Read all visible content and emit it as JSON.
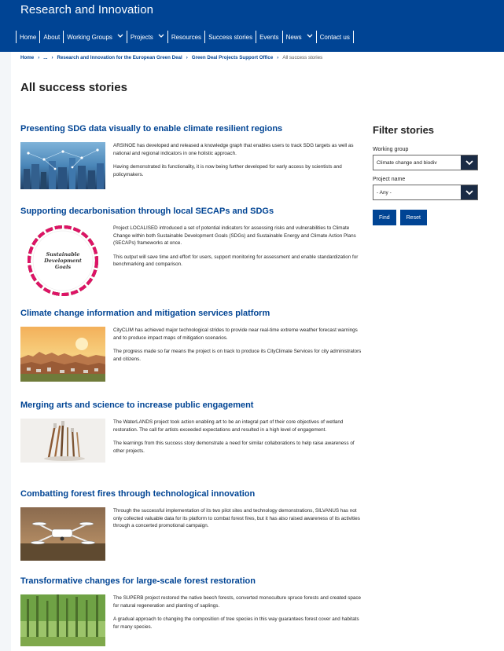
{
  "header": {
    "site_title": "Research and Innovation",
    "nav": [
      {
        "label": "Home",
        "dropdown": false
      },
      {
        "label": "About",
        "dropdown": false
      },
      {
        "label": "Working Groups",
        "dropdown": true
      },
      {
        "label": "Projects",
        "dropdown": true
      },
      {
        "label": "Resources",
        "dropdown": false
      },
      {
        "label": "Success stories",
        "dropdown": false
      },
      {
        "label": "Events",
        "dropdown": false
      },
      {
        "label": "News",
        "dropdown": true
      },
      {
        "label": "Contact us",
        "dropdown": false
      }
    ]
  },
  "breadcrumb": {
    "items": [
      "Home",
      "...",
      "Research and Innovation for the European Green Deal",
      "Green Deal Projects Support Office",
      "All success stories"
    ]
  },
  "page": {
    "title": "All success stories"
  },
  "stories": [
    {
      "title": "Presenting SDG data visually to enable climate resilient regions",
      "paragraphs": [
        "ARSINOE has developed and released a knowledge graph that enables users to track SDG targets as well as national and regional indicators in one holistic approach.",
        "Having demonstrated its functionality, it is now being further developed for early access by scientists and policymakers."
      ]
    },
    {
      "title": "Supporting decarbonisation through local SECAPs and SDGs",
      "paragraphs": [
        "Project LOCALISED introduced a set of potential indicators for assessing risks and vulnerabilities to Climate Change within both Sustainable Development Goals (SDGs) and Sustainable Energy and Climate Action Plans (SECAPs) frameworks at once.",
        "This output will save time and effort for users, support monitoring for assessment and enable standardization for benchmarking and comparison."
      ],
      "image_text": "Sustainable Development Goals"
    },
    {
      "title": "Climate change information and mitigation services platform",
      "paragraphs": [
        "CityCLIM has achieved major technological strides to provide near real-time extreme weather forecast warnings and to produce impact maps of mitigation scenarios.",
        "The progress made so far means the project is on track to produce its CityClimate Services for city administrators and citizens."
      ]
    },
    {
      "title": "Merging arts and science to increase public engagement",
      "paragraphs": [
        "The WaterLANDS project took action enabling art to be an integral part of their core objectives of wetland restoration. The call for artists exceeded expectations and resulted in a high level of engagement.",
        "The learnings from this success story demonstrate a need for similar collaborations to help raise awareness of other projects."
      ]
    },
    {
      "title": "Combatting forest fires through technological innovation",
      "paragraphs": [
        "Through the successful implementation of its two pilot sites and technology demonstrations, SILVANUS has not only collected valuable data for its platform to combat forest fires, but it has also raised awareness of its activities through a concerted promotional campaign."
      ]
    },
    {
      "title": "Transformative changes for large-scale forest restoration",
      "paragraphs": [
        "The SUPERB project restored the native beech forests, converted monoculture spruce forests and created space for natural regeneration and planting of saplings.",
        "A gradual approach to changing the composition of tree species in this way guarantees forest cover and habitats for many species."
      ]
    }
  ],
  "filter": {
    "title": "Filter stories",
    "working_group_label": "Working group",
    "working_group_value": "Climate change and biodiv",
    "project_name_label": "Project name",
    "project_name_value": "- Any -",
    "find_label": "Find",
    "reset_label": "Reset"
  },
  "colors": {
    "brand": "#004494",
    "select_arrow_bg": "#1a2b45"
  }
}
